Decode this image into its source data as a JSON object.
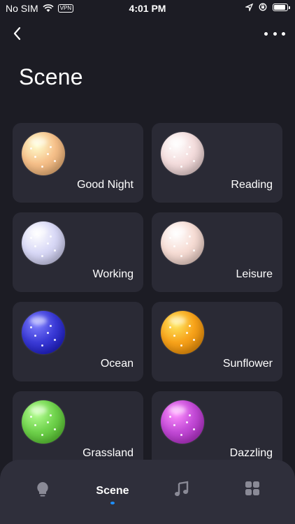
{
  "status": {
    "carrier": "No SIM",
    "vpn": "VPN",
    "time": "4:01 PM"
  },
  "nav": {
    "back_icon": "chevron-left-icon",
    "more_icon": "ellipsis-icon"
  },
  "page": {
    "title": "Scene"
  },
  "scenes": [
    {
      "label": "Good Night",
      "color": "#f6c08a"
    },
    {
      "label": "Reading",
      "color": "#f3dcdc"
    },
    {
      "label": "Working",
      "color": "#d8d8f6"
    },
    {
      "label": "Leisure",
      "color": "#f6dcd4"
    },
    {
      "label": "Ocean",
      "color": "#3a3ad6"
    },
    {
      "label": "Sunflower",
      "color": "#f7a21a"
    },
    {
      "label": "Grassland",
      "color": "#6fd24c"
    },
    {
      "label": "Dazzling",
      "color": "#c24ad6"
    }
  ],
  "tabs": {
    "light_icon": "lightbulb-icon",
    "scene_label": "Scene",
    "music_icon": "music-note-icon",
    "grid_icon": "grid-icon",
    "active_color": "#1e90ff"
  }
}
